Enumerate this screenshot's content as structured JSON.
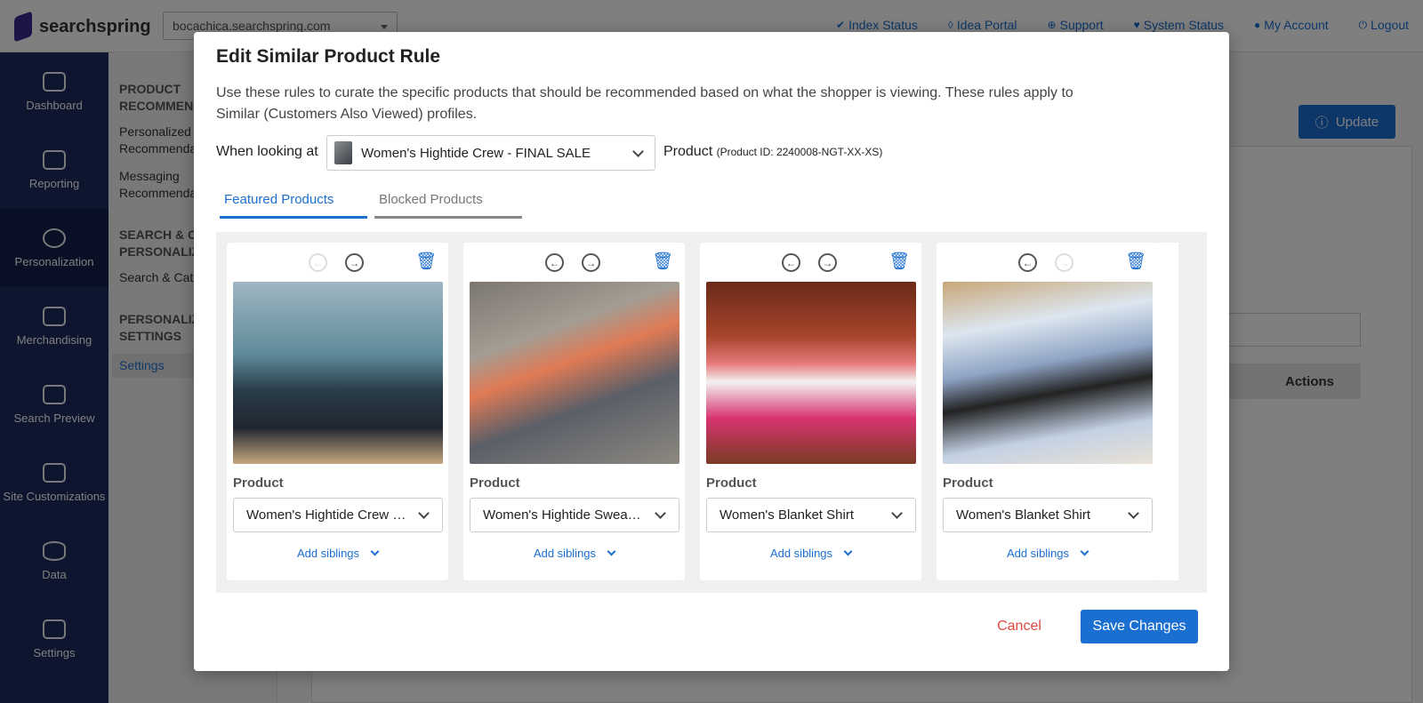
{
  "topbar": {
    "brand": "searchspring",
    "site": "bocachica.searchspring.com",
    "links": [
      "Index Status",
      "Idea Portal",
      "Support",
      "System Status",
      "My Account",
      "Logout"
    ]
  },
  "sidebar": {
    "items": [
      {
        "label": "Dashboard",
        "icon": "gauge-icon"
      },
      {
        "label": "Reporting",
        "icon": "chart-icon"
      },
      {
        "label": "Personalization",
        "icon": "target-icon"
      },
      {
        "label": "Merchandising",
        "icon": "bag-icon"
      },
      {
        "label": "Search Preview",
        "icon": "doc-search-icon"
      },
      {
        "label": "Site Customizations",
        "icon": "sliders-icon"
      },
      {
        "label": "Data",
        "icon": "database-icon"
      },
      {
        "label": "Settings",
        "icon": "wrench-icon"
      }
    ]
  },
  "subnav": {
    "h1": "PRODUCT RECOMMENDATIONS",
    "l1": "Personalized Recommendations",
    "l2": "Messaging Recommendations",
    "h2": "SEARCH & CATEGORY PERSONALIZATION",
    "l3": "Search & Category",
    "h3": "PERSONALIZATION SETTINGS",
    "l4": "Settings"
  },
  "background": {
    "update_label": "Update",
    "actions_header": "Actions"
  },
  "modal": {
    "title": "Edit Similar Product Rule",
    "description": "Use these rules to curate the specific products that should be recommended based on what the shopper is viewing. These rules apply to Similar (Customers Also Viewed) profiles.",
    "when_label": "When looking at",
    "selected_product": "Women's Hightide Crew - FINAL SALE",
    "product_label": "Product",
    "product_id": "(Product ID: 2240008-NGT-XX-XS)",
    "tabs": [
      "Featured Products",
      "Blocked Products"
    ],
    "cards": [
      {
        "label": "Product",
        "value": "Women's Hightide Crew - FINAL SALE",
        "siblings": "Add siblings"
      },
      {
        "label": "Product",
        "value": "Women's Hightide Sweatpant",
        "siblings": "Add siblings"
      },
      {
        "label": "Product",
        "value": "Women's Blanket Shirt",
        "siblings": "Add siblings"
      },
      {
        "label": "Product",
        "value": "Women's Blanket Shirt",
        "siblings": "Add siblings"
      }
    ],
    "cancel_label": "Cancel",
    "save_label": "Save Changes"
  },
  "colors": {
    "accent": "#1b6fd1",
    "nav": "#1a2b5f",
    "danger": "#e0473d"
  }
}
